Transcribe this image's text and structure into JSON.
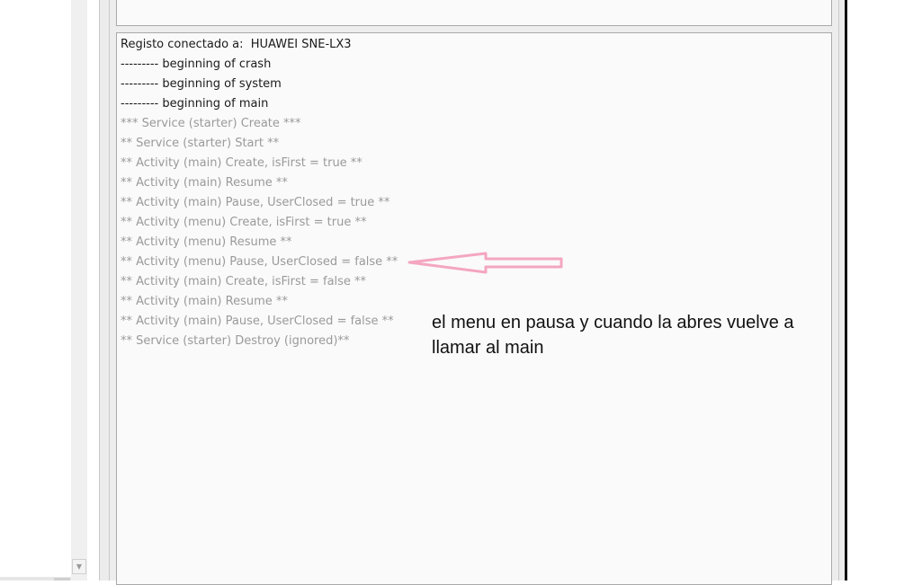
{
  "log": {
    "lines": [
      {
        "text": "Registo conectado a:  HUAWEI SNE-LX3",
        "style": "strong"
      },
      {
        "text": "--------- beginning of crash",
        "style": "strong"
      },
      {
        "text": "--------- beginning of system",
        "style": "strong"
      },
      {
        "text": "--------- beginning of main",
        "style": "strong"
      },
      {
        "text": "*** Service (starter) Create ***",
        "style": "dim"
      },
      {
        "text": "** Service (starter) Start **",
        "style": "dim"
      },
      {
        "text": "** Activity (main) Create, isFirst = true **",
        "style": "dim"
      },
      {
        "text": "** Activity (main) Resume **",
        "style": "dim"
      },
      {
        "text": "** Activity (main) Pause, UserClosed = true **",
        "style": "dim"
      },
      {
        "text": "** Activity (menu) Create, isFirst = true **",
        "style": "dim"
      },
      {
        "text": "** Activity (menu) Resume **",
        "style": "dim"
      },
      {
        "text": "** Activity (menu) Pause, UserClosed = false **",
        "style": "dim"
      },
      {
        "text": "** Activity (main) Create, isFirst = false **",
        "style": "dim"
      },
      {
        "text": "** Activity (main) Resume **",
        "style": "dim"
      },
      {
        "text": "** Activity (main) Pause, UserClosed = false **",
        "style": "dim"
      },
      {
        "text": "** Service (starter) Destroy (ignored)**",
        "style": "dim"
      }
    ]
  },
  "annotation": {
    "text": "el menu en pausa y cuando la abres vuelve a llamar al main",
    "arrow_color": "#f4a6c0"
  },
  "colors": {
    "strong_text": "#1a1a1a",
    "dim_text": "#9a9a9a",
    "panel_background": "#fafafa",
    "panel_border": "#a9a9a9"
  },
  "icons": {
    "scroll_down": "chevron-down-icon"
  }
}
